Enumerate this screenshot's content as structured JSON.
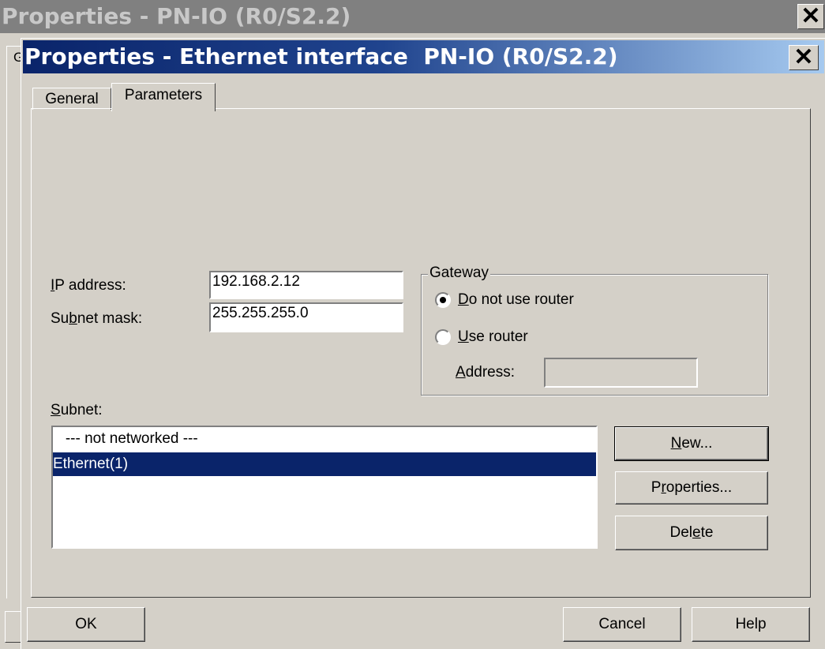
{
  "background_window": {
    "title": "Properties - PN-IO (R0/S2.2)",
    "tab_fragment": "G",
    "close_glyph": "✕"
  },
  "dialog": {
    "title": "Properties - Ethernet interface  PN-IO (R0/S2.2)",
    "close_glyph": "✕",
    "tabs": [
      {
        "label": "General"
      },
      {
        "label": "Parameters"
      }
    ],
    "ip_address": {
      "label_pre": "",
      "label_u": "I",
      "label_post": "P address:",
      "value": "192.168.2.12"
    },
    "subnet_mask": {
      "label_pre": "Su",
      "label_u": "b",
      "label_post": "net mask:",
      "value": "255.255.255.0"
    },
    "gateway": {
      "legend": "Gateway",
      "no_router": {
        "label_u": "D",
        "label_post": "o not use router"
      },
      "use_router": {
        "label_u": "U",
        "label_post": "se router"
      },
      "address": {
        "label_u": "A",
        "label_post": "ddress:",
        "value": ""
      }
    },
    "subnet": {
      "label_u": "S",
      "label_post": "ubnet:",
      "items": [
        "   --- not networked ---",
        "Ethernet(1)"
      ],
      "selected_index": 1
    },
    "buttons": {
      "new": {
        "pre": "",
        "u": "N",
        "post": "ew..."
      },
      "properties": {
        "pre": "P",
        "u": "r",
        "post": "operties..."
      },
      "delete": {
        "pre": "Del",
        "u": "e",
        "post": "te"
      },
      "ok": "OK",
      "cancel": "Cancel",
      "help": "Help"
    }
  }
}
